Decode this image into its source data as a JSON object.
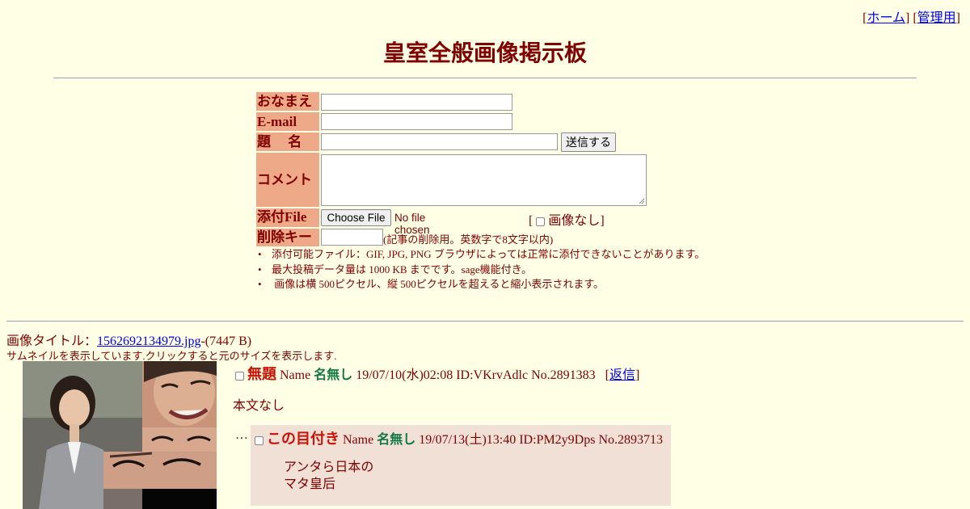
{
  "nav": {
    "bracket_open": "[",
    "bracket_close": "]",
    "home": "ホーム",
    "admin": "管理用"
  },
  "title": "皇室全般画像掲示板",
  "form": {
    "name_label": "おなまえ",
    "email_label": "E-mail",
    "subject_label": "題　 名",
    "submit": "送信する",
    "comment_label": "コメント",
    "file_label": "添付File",
    "choose_file": "Choose File",
    "no_file": "No file chosen",
    "no_image": "画像なし",
    "delkey_label": "削除キー",
    "delkey_note": "(記事の削除用。英数字で8文字以内)"
  },
  "notes": [
    "添付可能ファイル：GIF, JPG, PNG ブラウザによっては正常に添付できないことがあります。",
    "最大投稿データ量は 1000 KB までです。sage機能付き。",
    " 画像は横 500ピクセル、縦 500ピクセルを超えると縮小表示されます。"
  ],
  "post": {
    "image_title_label": "画像タイトル：",
    "image_file": "1562692134979.jpg",
    "image_size": "-(7447 B)",
    "thumb_note": "サムネイルを表示しています.クリックすると元のサイズを表示します.",
    "subject": "無題",
    "name_word": "Name",
    "name": "名無し",
    "datetime": "19/07/10(水)02:08 ID:VKrvAdlc No.2891383",
    "reply_link": "返信",
    "body": "本文なし"
  },
  "reply": {
    "dots": "…",
    "subject": "この目付き",
    "name_word": "Name",
    "name": "名無し",
    "datetime": "19/07/13(土)13:40 ID:PM2y9Dps No.2893713",
    "line1": "アンタら日本の",
    "line2": "マタ皇后"
  }
}
